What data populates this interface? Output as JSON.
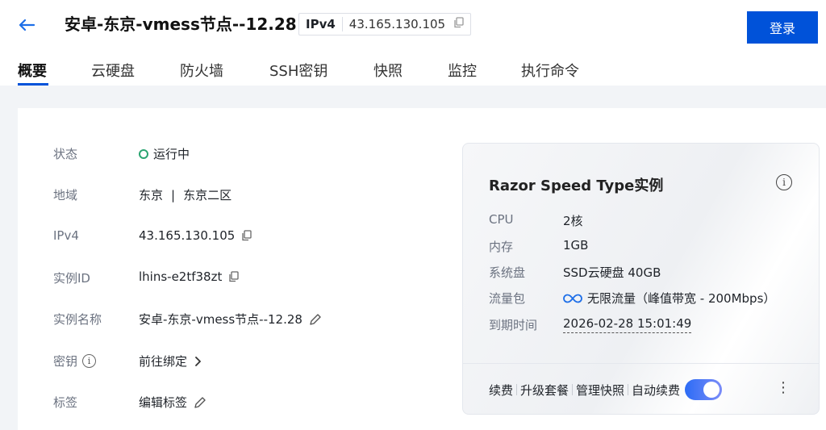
{
  "header": {
    "title": "安卓-东京-vmess节点--12.28",
    "ip_label": "IPv4",
    "ip_value": "43.165.130.105",
    "login_label": "登录"
  },
  "tabs": [
    {
      "label": "概要",
      "active": true
    },
    {
      "label": "云硬盘"
    },
    {
      "label": "防火墙"
    },
    {
      "label": "SSH密钥"
    },
    {
      "label": "快照"
    },
    {
      "label": "监控"
    },
    {
      "label": "执行命令"
    }
  ],
  "details": {
    "status_label": "状态",
    "status_value": "运行中",
    "region_label": "地域",
    "region_city": "东京",
    "region_sep": "|",
    "region_zone": "东京二区",
    "ipv4_label": "IPv4",
    "ipv4_value": "43.165.130.105",
    "instance_id_label": "实例ID",
    "instance_id_value": "lhins-e2tf38zt",
    "instance_name_label": "实例名称",
    "instance_name_value": "安卓-东京-vmess节点--12.28",
    "key_label": "密钥",
    "key_value": "前往绑定",
    "tag_label": "标签",
    "tag_value": "编辑标签"
  },
  "card": {
    "title": "Razor Speed Type实例",
    "specs": {
      "cpu_label": "CPU",
      "cpu_value": "2核",
      "mem_label": "内存",
      "mem_value": "1GB",
      "disk_label": "系统盘",
      "disk_value": "SSD云硬盘 40GB",
      "traffic_label": "流量包",
      "traffic_value": "无限流量（峰值带宽 - 200Mbps）",
      "expire_label": "到期时间",
      "expire_value": "2026-02-28 15:01:49"
    },
    "actions": {
      "renew": "续费",
      "upgrade": "升级套餐",
      "snapshot": "管理快照",
      "auto_renew": "自动续费",
      "auto_renew_on": true
    }
  },
  "colors": {
    "primary": "#0052d9",
    "status_green": "#2ba471",
    "infinity_blue": "#1e6fe8"
  }
}
